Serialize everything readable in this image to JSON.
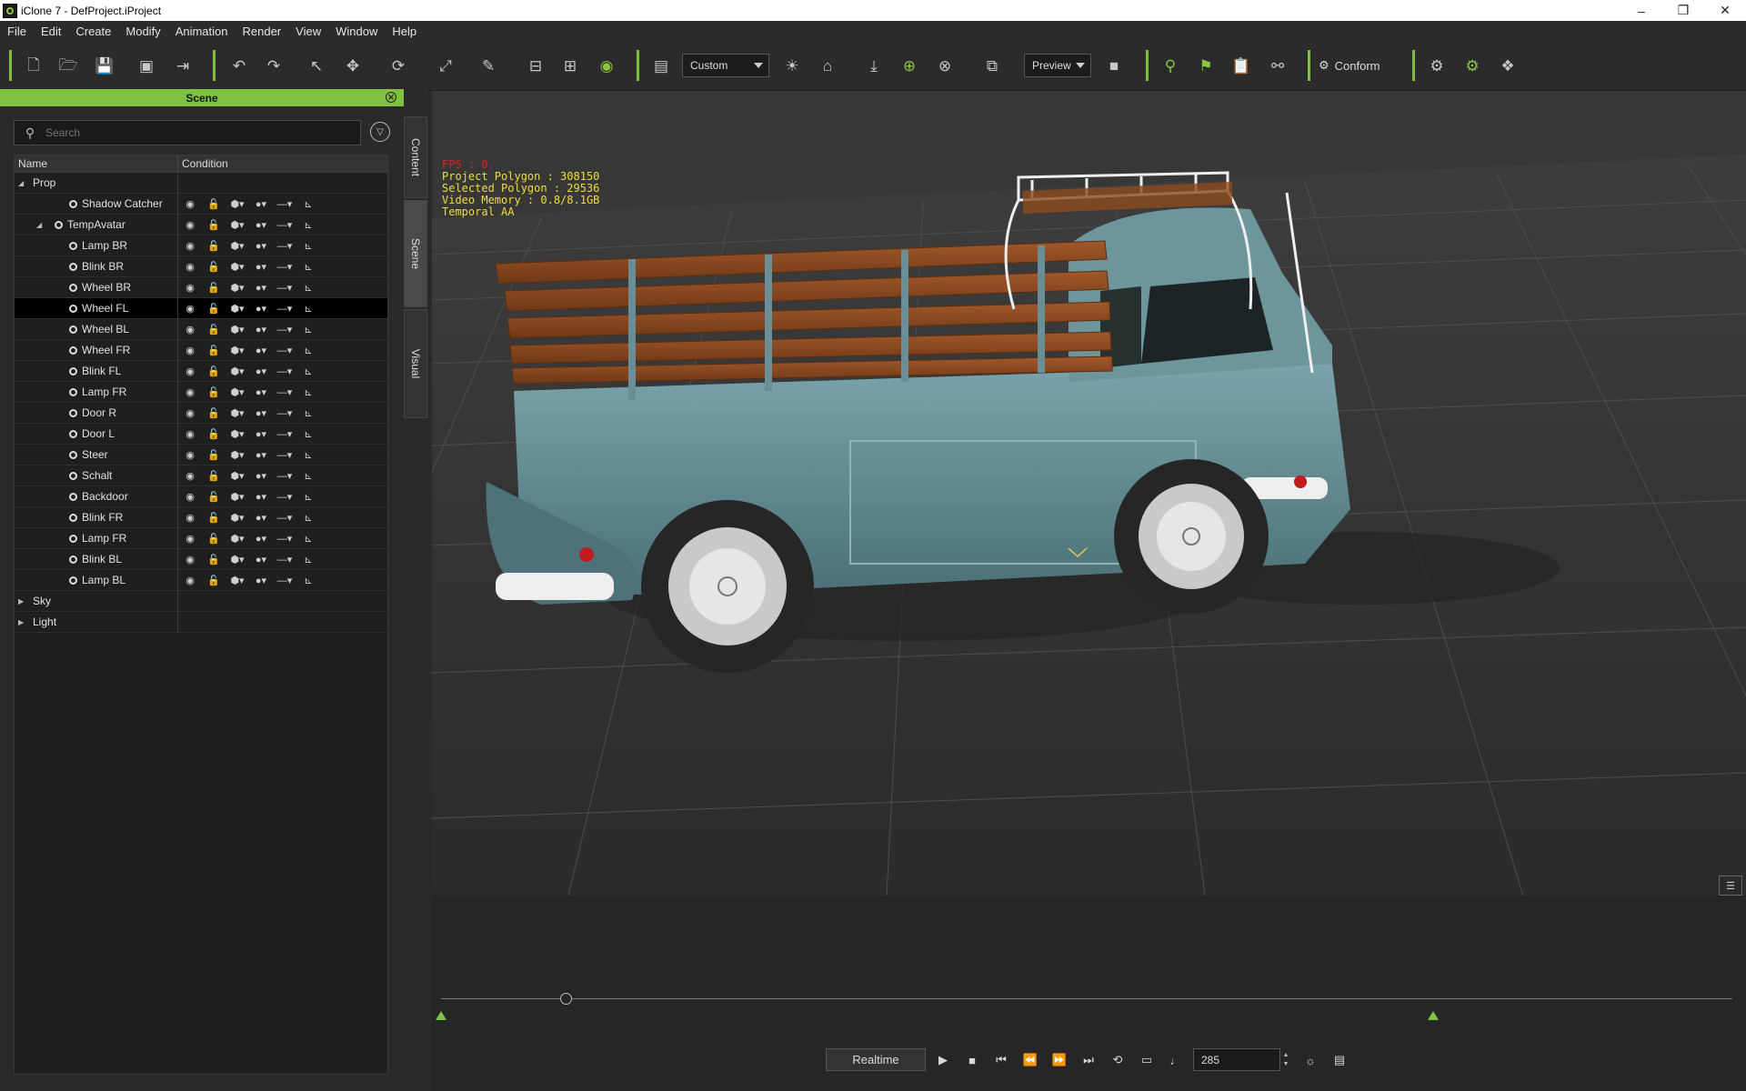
{
  "window": {
    "title": "iClone 7 - DefProject.iProject",
    "minimize": "–",
    "restore": "❐",
    "close": "✕"
  },
  "menu": [
    "File",
    "Edit",
    "Create",
    "Modify",
    "Animation",
    "Render",
    "View",
    "Window",
    "Help"
  ],
  "toolbar": {
    "camera_dropdown": "Custom",
    "mode_dropdown": "Preview",
    "conform_label": "Conform"
  },
  "scene_panel": {
    "title": "Scene",
    "search_placeholder": "Search",
    "columns": [
      "Name",
      "Condition"
    ],
    "items": [
      {
        "label": "Prop",
        "level": 0,
        "expand": "◢",
        "icon": false
      },
      {
        "label": "Shadow Catcher",
        "level": 2,
        "expand": "",
        "icon": true
      },
      {
        "label": "TempAvatar",
        "level": 1,
        "expand": "◢",
        "icon": true
      },
      {
        "label": "Lamp BR",
        "level": 2,
        "expand": "",
        "icon": true
      },
      {
        "label": "Blink BR",
        "level": 2,
        "expand": "",
        "icon": true
      },
      {
        "label": "Wheel BR",
        "level": 2,
        "expand": "",
        "icon": true
      },
      {
        "label": "Wheel FL",
        "level": 2,
        "expand": "",
        "icon": true,
        "selected": true
      },
      {
        "label": "Wheel BL",
        "level": 2,
        "expand": "",
        "icon": true
      },
      {
        "label": "Wheel FR",
        "level": 2,
        "expand": "",
        "icon": true
      },
      {
        "label": "Blink FL",
        "level": 2,
        "expand": "",
        "icon": true
      },
      {
        "label": "Lamp FR",
        "level": 2,
        "expand": "",
        "icon": true
      },
      {
        "label": "Door R",
        "level": 2,
        "expand": "",
        "icon": true
      },
      {
        "label": "Door L",
        "level": 2,
        "expand": "",
        "icon": true
      },
      {
        "label": "Steer",
        "level": 2,
        "expand": "",
        "icon": true
      },
      {
        "label": "Schalt",
        "level": 2,
        "expand": "",
        "icon": true
      },
      {
        "label": "Backdoor",
        "level": 2,
        "expand": "",
        "icon": true
      },
      {
        "label": "Blink FR",
        "level": 2,
        "expand": "",
        "icon": true
      },
      {
        "label": "Lamp FR",
        "level": 2,
        "expand": "",
        "icon": true
      },
      {
        "label": "Blink BL",
        "level": 2,
        "expand": "",
        "icon": true
      },
      {
        "label": "Lamp BL",
        "level": 2,
        "expand": "",
        "icon": true
      },
      {
        "label": "Sky",
        "level": 0,
        "expand": "▶",
        "icon": false,
        "nocond": true
      },
      {
        "label": "Light",
        "level": 0,
        "expand": "▶",
        "icon": false,
        "nocond": true
      }
    ]
  },
  "side_tabs": [
    "Content",
    "Scene",
    "Visual"
  ],
  "viewport_stats": {
    "fps": "FPS : 0.",
    "project_polygon": "Project Polygon : 308150",
    "selected_polygon": "Selected Polygon : 29536",
    "video_memory": "Video Memory : 0.8/8.1GB",
    "aa": "Temporal AA"
  },
  "playback": {
    "mode": "Realtime",
    "frame": "285"
  },
  "colors": {
    "accent": "#7fc241",
    "stats_text": "#f0dc3c",
    "fps_text": "#e02020",
    "vehicle_body": "#5e8890",
    "rack_wood": "#8a4a22"
  }
}
